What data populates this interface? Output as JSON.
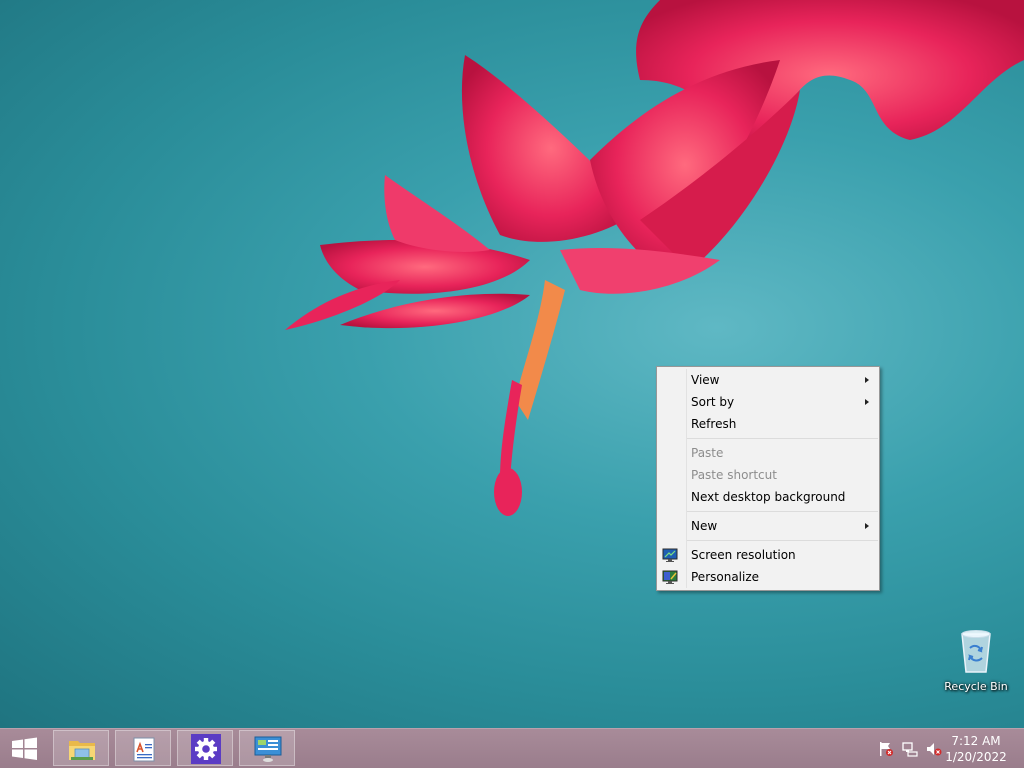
{
  "context_menu": {
    "items": [
      {
        "label": "View",
        "has_submenu": true,
        "disabled": false
      },
      {
        "label": "Sort by",
        "has_submenu": true,
        "disabled": false
      },
      {
        "label": "Refresh",
        "has_submenu": false,
        "disabled": false
      },
      {
        "label": "Paste",
        "has_submenu": false,
        "disabled": true
      },
      {
        "label": "Paste shortcut",
        "has_submenu": false,
        "disabled": true
      },
      {
        "label": "Next desktop background",
        "has_submenu": false,
        "disabled": false
      },
      {
        "label": "New",
        "has_submenu": true,
        "disabled": false
      },
      {
        "label": "Screen resolution",
        "icon": "monitor-icon",
        "disabled": false
      },
      {
        "label": "Personalize",
        "icon": "personalize-icon",
        "disabled": false
      }
    ]
  },
  "desktop": {
    "icons": [
      {
        "label": "Recycle Bin",
        "icon": "recycle-bin-icon"
      }
    ]
  },
  "taskbar": {
    "buttons": [
      {
        "name": "file-explorer",
        "icon": "folder-icon"
      },
      {
        "name": "wordpad",
        "icon": "document-icon"
      },
      {
        "name": "settings",
        "icon": "gear-icon"
      },
      {
        "name": "control-panel",
        "icon": "control-panel-icon"
      }
    ],
    "tray": {
      "icons": [
        "action-center-flag-icon",
        "network-icon",
        "volume-muted-icon"
      ],
      "time": "7:12 AM",
      "date": "1/20/2022"
    }
  },
  "colors": {
    "wallpaper": "#3aa0ad",
    "flower": "#e8245a",
    "taskbar": "#9f8291",
    "menu_bg": "#f2f2f2",
    "settings_tile": "#5b3cc4"
  }
}
